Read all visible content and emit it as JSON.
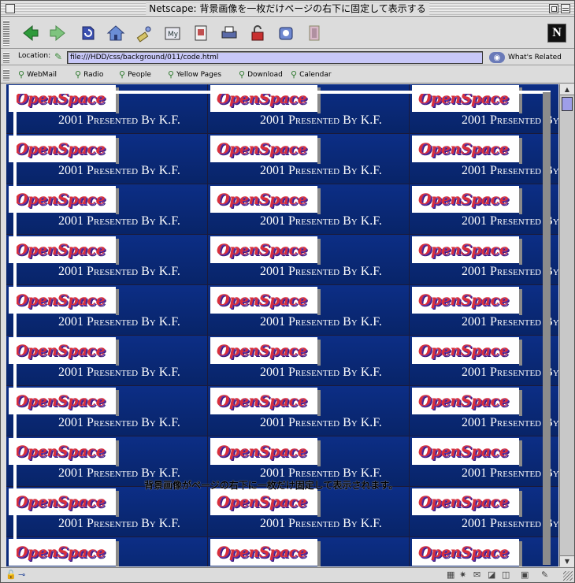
{
  "window": {
    "title": "Netscape: 背景画像を一枚だけページの右下に固定して表示する"
  },
  "toolbar": {
    "buttons": [
      {
        "name": "back-icon",
        "glyph": "◀"
      },
      {
        "name": "forward-icon",
        "glyph": "▶"
      },
      {
        "name": "reload-icon",
        "glyph": "↻"
      },
      {
        "name": "home-icon",
        "glyph": "⌂"
      },
      {
        "name": "search-icon",
        "glyph": "✎"
      },
      {
        "name": "my-netscape-icon",
        "glyph": "My"
      },
      {
        "name": "images-icon",
        "glyph": "▤"
      },
      {
        "name": "print-icon",
        "glyph": "⎙"
      },
      {
        "name": "security-icon",
        "glyph": "🔓"
      },
      {
        "name": "shop-icon",
        "glyph": "◎"
      },
      {
        "name": "stop-icon",
        "glyph": "▥"
      }
    ],
    "logo": "N"
  },
  "location": {
    "label": "Location:",
    "url": "file:///HDD/css/background/011/code.html",
    "whats_related": "What's Related"
  },
  "personal_toolbar": {
    "items": [
      "WebMail",
      "Radio",
      "People",
      "Yellow Pages",
      "Download",
      "Calendar"
    ]
  },
  "page": {
    "logo_text": "OpenSpace",
    "caption": "2001 Presented By K.F.",
    "overlay_text": "背景画像がページの右下に一枚だけ固定して表示されます。"
  },
  "colors": {
    "tile_background": "#0b2a80",
    "logo_red": "#d8303c",
    "location_field": "#c8c8f8",
    "scroll_thumb": "#9e9ee8"
  }
}
